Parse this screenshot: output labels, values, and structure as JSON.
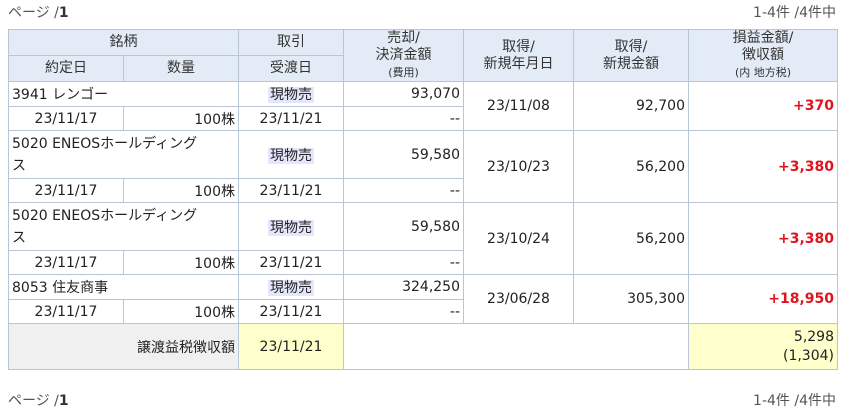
{
  "pager": {
    "page_label": "ページ /",
    "page_num": "1",
    "count": "1-4件 /4件中"
  },
  "headers": {
    "meigara": "銘柄",
    "torihiki": "取引",
    "baikyaku_1": "売却/",
    "baikyaku_2": "決済金額",
    "baikyaku_3": "(費用)",
    "shutoku_date_1": "取得/",
    "shutoku_date_2": "新規年月日",
    "shutoku_amt_1": "取得/",
    "shutoku_amt_2": "新規金額",
    "soneki_1": "損益金額/",
    "soneki_2": "徴収額",
    "soneki_3": "(内 地方税)",
    "yakujobi": "約定日",
    "suryo": "数量",
    "ukewatashibi": "受渡日"
  },
  "rows": [
    {
      "name_line1": "3941 レンゴー",
      "name_line2": "",
      "trade": "現物売",
      "sell_amount": "93,070",
      "fee": "--",
      "acq_date": "23/11/08",
      "acq_amount": "92,700",
      "pnl": "+370",
      "exec_date": "23/11/17",
      "qty": "100株",
      "settle_date": "23/11/21"
    },
    {
      "name_line1": "5020 ENEOSホールディング",
      "name_line2": "ス",
      "trade": "現物売",
      "sell_amount": "59,580",
      "fee": "--",
      "acq_date": "23/10/23",
      "acq_amount": "56,200",
      "pnl": "+3,380",
      "exec_date": "23/11/17",
      "qty": "100株",
      "settle_date": "23/11/21"
    },
    {
      "name_line1": "5020 ENEOSホールディング",
      "name_line2": "ス",
      "trade": "現物売",
      "sell_amount": "59,580",
      "fee": "--",
      "acq_date": "23/10/24",
      "acq_amount": "56,200",
      "pnl": "+3,380",
      "exec_date": "23/11/17",
      "qty": "100株",
      "settle_date": "23/11/21"
    },
    {
      "name_line1": "8053 住友商事",
      "name_line2": "",
      "trade": "現物売",
      "sell_amount": "324,250",
      "fee": "--",
      "acq_date": "23/06/28",
      "acq_amount": "305,300",
      "pnl": "+18,950",
      "exec_date": "23/11/17",
      "qty": "100株",
      "settle_date": "23/11/21"
    }
  ],
  "footer": {
    "label": "譲渡益税徴収額",
    "date": "23/11/21",
    "amount": "5,298",
    "local_tax": "(1,304)"
  }
}
